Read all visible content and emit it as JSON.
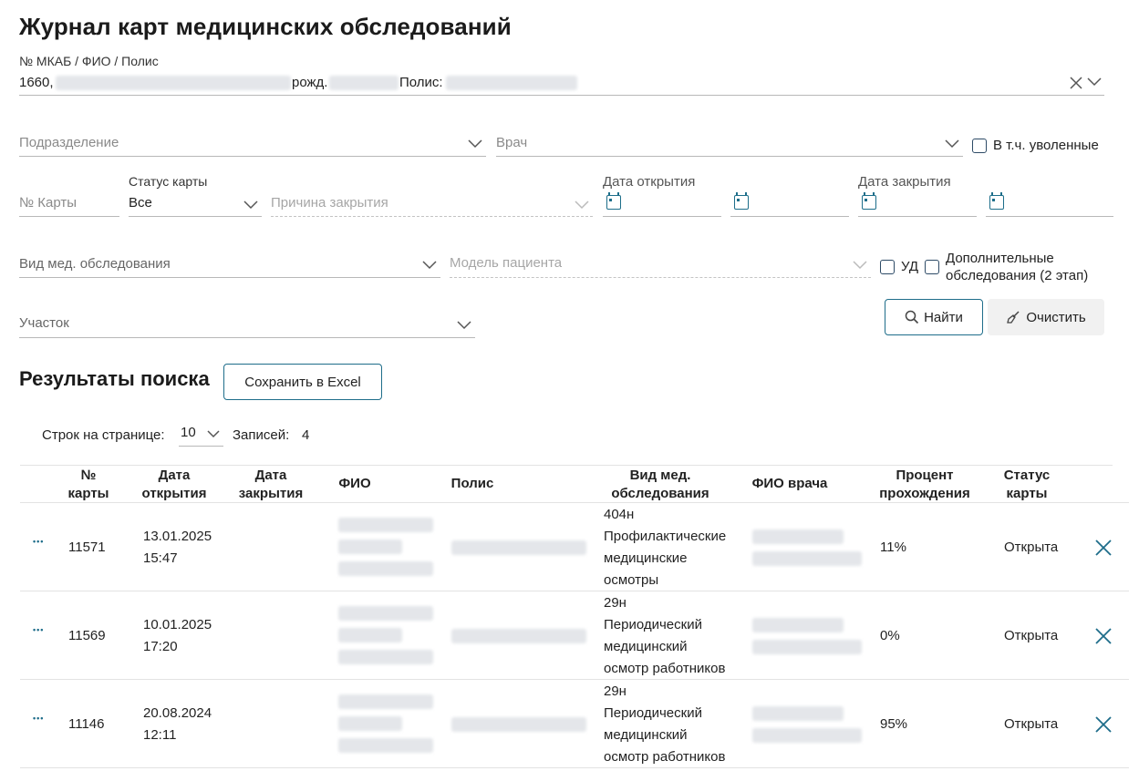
{
  "page": {
    "title": "Журнал карт медицинских обследований"
  },
  "patient": {
    "label": "№ МКАБ / ФИО / Полис",
    "prefix": "1660,",
    "birth_label": "рожд.",
    "policy_label": "Полис:"
  },
  "filters": {
    "subdivision_placeholder": "Подразделение",
    "doctor_placeholder": "Врач",
    "dismissed_label": "В т.ч. уволенные",
    "card_number_placeholder": "№ Карты",
    "card_status_label": "Статус карты",
    "card_status_value": "Все",
    "close_reason_placeholder": "Причина закрытия",
    "open_date_label": "Дата открытия",
    "close_date_label": "Дата закрытия",
    "exam_type_placeholder": "Вид мед. обследования",
    "patient_model_placeholder": "Модель пациента",
    "ud_label": "УД",
    "additional_label_1": "Дополнительные",
    "additional_label_2": "обследования (2 этап)",
    "area_placeholder": "Участок"
  },
  "actions": {
    "find_label": "Найти",
    "clear_label": "Очистить",
    "excel_label": "Сохранить в Excel"
  },
  "results": {
    "title": "Результаты поиска",
    "rows_per_page_label": "Строк на странице:",
    "rows_per_page_value": "10",
    "records_label": "Записей:",
    "records_value": "4"
  },
  "table": {
    "headers": [
      [
        "№",
        "карты"
      ],
      [
        "Дата",
        "открытия"
      ],
      [
        "Дата",
        "закрытия"
      ],
      [
        "ФИО"
      ],
      [
        "Полис"
      ],
      [
        "Вид мед.",
        "обследования"
      ],
      [
        "ФИО врача"
      ],
      [
        "Процент",
        "прохождения"
      ],
      [
        "Статус",
        "карты"
      ]
    ],
    "rows": [
      {
        "number": "11571",
        "open_date": "13.01.2025",
        "open_time": "15:47",
        "close_date": "",
        "exam": [
          "404н",
          "Профилактические",
          "медицинские",
          "осмотры"
        ],
        "percent": "11%",
        "status": "Открыта"
      },
      {
        "number": "11569",
        "open_date": "10.01.2025",
        "open_time": "17:20",
        "close_date": "",
        "exam": [
          "29н",
          "Периодический",
          "медицинский",
          "осмотр работников"
        ],
        "percent": "0%",
        "status": "Открыта"
      },
      {
        "number": "11146",
        "open_date": "20.08.2024",
        "open_time": "12:11",
        "close_date": "",
        "exam": [
          "29н",
          "Периодический",
          "медицинский",
          "осмотр работников"
        ],
        "percent": "95%",
        "status": "Открыта"
      }
    ]
  },
  "colors": {
    "accent": "#1e6d8a",
    "border": "#b8b8b8"
  }
}
